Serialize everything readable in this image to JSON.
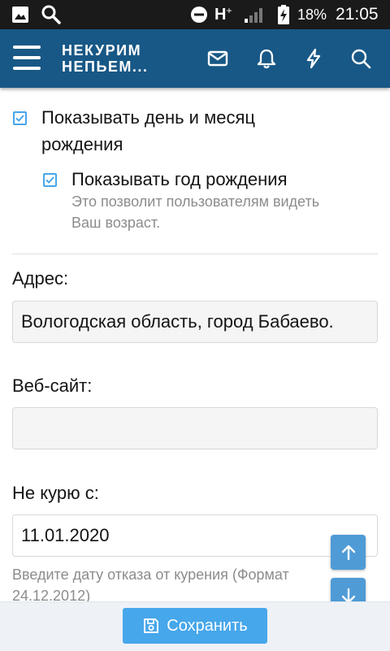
{
  "status_bar": {
    "network_label": "H",
    "network_sup": "+",
    "battery_percent": "18%",
    "time": "21:05",
    "icons": [
      "image-icon",
      "search-icon",
      "do-not-disturb-icon",
      "signal-icon",
      "battery-charging-icon"
    ]
  },
  "app_bar": {
    "logo_line1": "НЕКУРИМ",
    "logo_line2": "НЕПЬЕМ...",
    "icons": [
      "menu-icon",
      "mail-icon",
      "bell-icon",
      "lightning-icon",
      "search-icon"
    ],
    "background": "#185886"
  },
  "form": {
    "show_birthday": {
      "label_line1": "Показывать день и месяц",
      "label_line2": "рождения",
      "checked": true
    },
    "show_birth_year": {
      "label": "Показывать год рождения",
      "hint_line1": "Это позволит пользователям видеть",
      "hint_line2": "Ваш возраст.",
      "checked": true
    },
    "address": {
      "label": "Адрес:",
      "value": "Вологодская область, город Бабаево."
    },
    "website": {
      "label": "Веб-сайт:",
      "value": ""
    },
    "quit_date": {
      "label": "Не курю с:",
      "value": "11.01.2020",
      "hint_line1": "Введите дату отказа от курения (Формат",
      "hint_line2": "24.12.2012)"
    }
  },
  "actions": {
    "save_label": "Сохранить",
    "accent": "#47a7eb"
  }
}
